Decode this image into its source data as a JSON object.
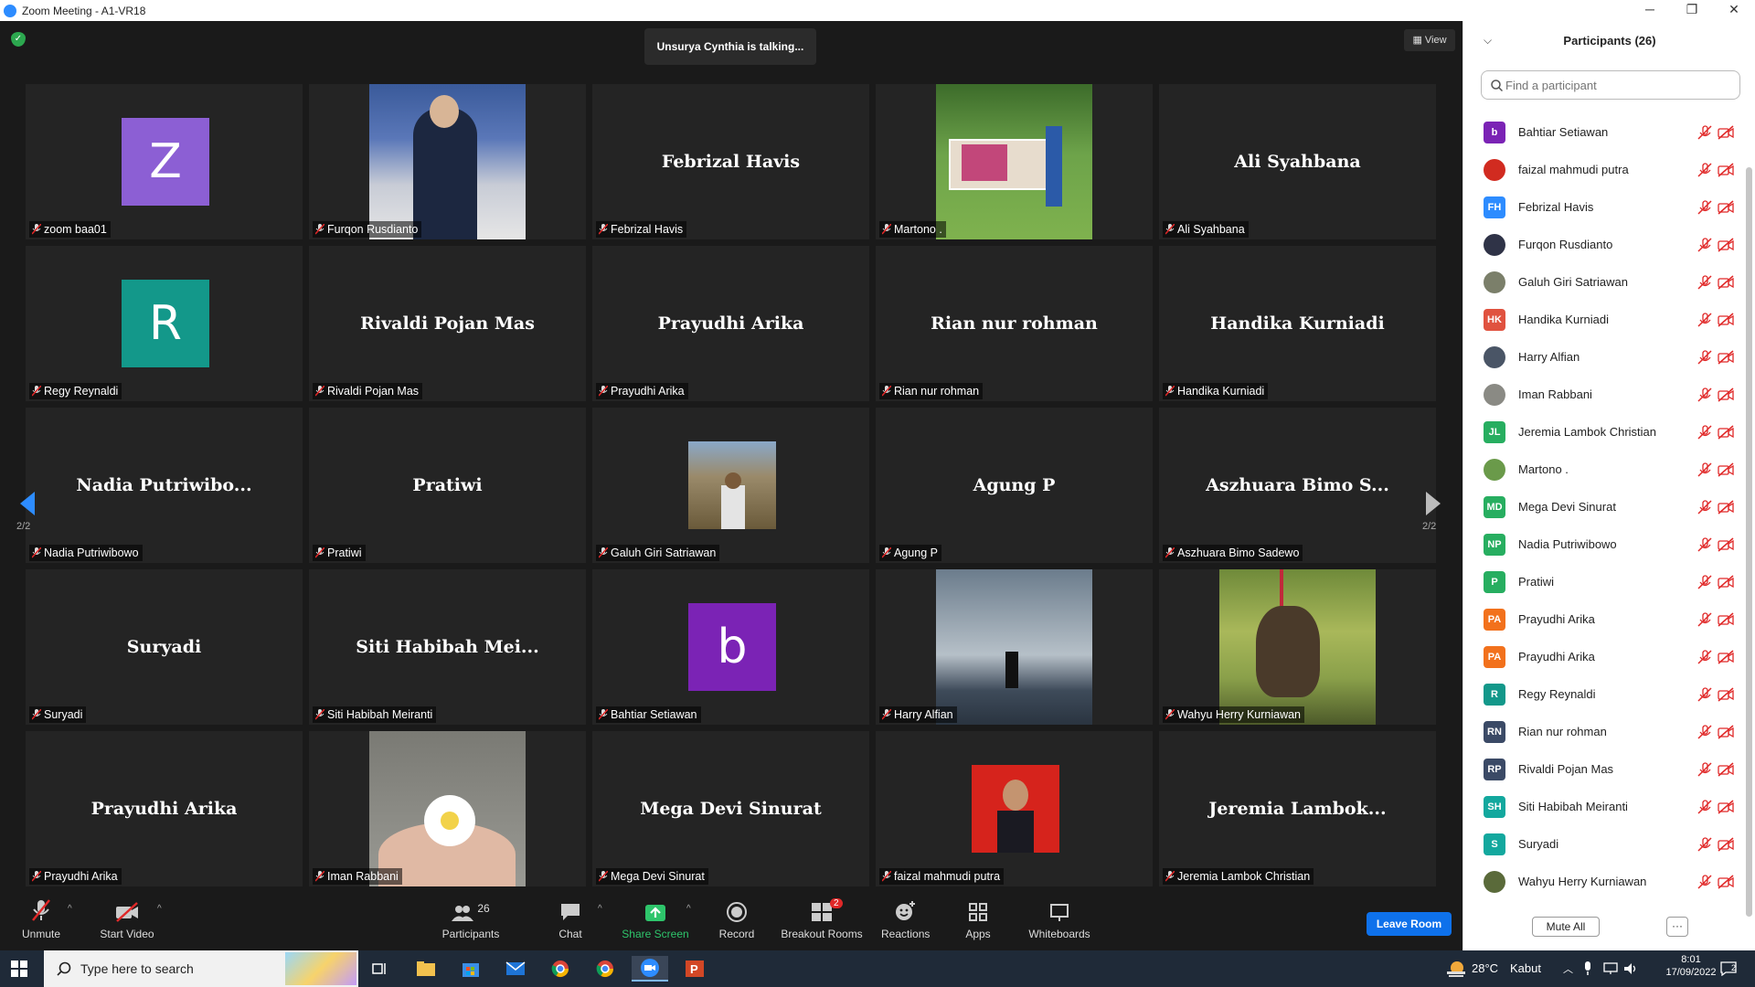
{
  "window": {
    "title": "Zoom Meeting - A1-VR18",
    "min_glyph": "─",
    "restore_glyph": "❐",
    "close_glyph": "✕"
  },
  "meeting": {
    "talking_text": "Unsurya Cynthia is talking...",
    "view_label": "View",
    "page_indicator_left": "2/2",
    "page_indicator_right": "2/2"
  },
  "tiles": [
    {
      "name": "zoom baa01",
      "type": "avatar",
      "letter": "Z",
      "color": "#8c5fd4"
    },
    {
      "name": "Furqon Rusdianto",
      "type": "photo",
      "photo": "person-event"
    },
    {
      "name": "Febrizal Havis",
      "type": "text",
      "display": "Febrizal Havis"
    },
    {
      "name": "Martono .",
      "type": "photo",
      "photo": "outdoor-banner"
    },
    {
      "name": "Ali Syahbana",
      "type": "text",
      "display": "Ali Syahbana"
    },
    {
      "name": "Regy Reynaldi",
      "type": "avatar",
      "letter": "R",
      "color": "#13988a"
    },
    {
      "name": "Rivaldi Pojan Mas",
      "type": "text",
      "display": "Rivaldi Pojan Mas"
    },
    {
      "name": "Prayudhi Arika",
      "type": "text",
      "display": "Prayudhi Arika"
    },
    {
      "name": "Rian nur rohman",
      "type": "text",
      "display": "Rian nur rohman"
    },
    {
      "name": "Handika Kurniadi",
      "type": "text",
      "display": "Handika Kurniadi"
    },
    {
      "name": "Nadia Putriwibowo",
      "type": "text",
      "display": "Nadia  Putriwibo..."
    },
    {
      "name": "Pratiwi",
      "type": "text",
      "display": "Pratiwi"
    },
    {
      "name": "Galuh Giri Satriawan",
      "type": "photo-small",
      "photo": "mountain-person"
    },
    {
      "name": "Agung P",
      "type": "text",
      "display": "Agung P"
    },
    {
      "name": "Aszhuara Bimo Sadewo",
      "type": "text",
      "display": "Aszhuara  Bimo  S..."
    },
    {
      "name": "Suryadi",
      "type": "text",
      "display": "Suryadi"
    },
    {
      "name": "Siti Habibah Meiranti",
      "type": "text",
      "display": "Siti  Habibah  Mei..."
    },
    {
      "name": "Bahtiar Setiawan",
      "type": "avatar",
      "letter": "b",
      "color": "#7b23b5"
    },
    {
      "name": "Harry Alfian",
      "type": "photo",
      "photo": "waterfall"
    },
    {
      "name": "Wahyu Herry Kurniawan",
      "type": "photo",
      "photo": "fishing"
    },
    {
      "name": "Prayudhi Arika",
      "type": "text",
      "display": "Prayudhi Arika"
    },
    {
      "name": "Iman Rabbani",
      "type": "photo",
      "photo": "flower-hand"
    },
    {
      "name": "Mega Devi Sinurat",
      "type": "text",
      "display": "Mega Devi Sinurat"
    },
    {
      "name": "faizal mahmudi putra",
      "type": "photo-small",
      "photo": "red-portrait"
    },
    {
      "name": "Jeremia Lambok Christian",
      "type": "text",
      "display": "Jeremia  Lambok..."
    }
  ],
  "toolbar": {
    "unmute": "Unmute",
    "start_video": "Start Video",
    "participants": "Participants",
    "participants_count": "26",
    "chat": "Chat",
    "share_screen": "Share Screen",
    "record": "Record",
    "breakout_rooms": "Breakout Rooms",
    "breakout_badge": "2",
    "reactions": "Reactions",
    "apps": "Apps",
    "whiteboards": "Whiteboards",
    "leave_room": "Leave Room",
    "caret_glyph": "^"
  },
  "panel": {
    "title": "Participants (26)",
    "search_placeholder": "Find a participant",
    "mute_all": "Mute All",
    "more": "···",
    "participants": [
      {
        "name": "Bahtiar Setiawan",
        "initials": "b",
        "color": "#7b23b5",
        "kind": "initials"
      },
      {
        "name": "faizal mahmudi putra",
        "initials": "",
        "color": "#d12b20",
        "kind": "photo"
      },
      {
        "name": "Febrizal Havis",
        "initials": "FH",
        "color": "#2d8cff",
        "kind": "initials"
      },
      {
        "name": "Furqon Rusdianto",
        "initials": "",
        "color": "#2f3347",
        "kind": "photo"
      },
      {
        "name": "Galuh Giri Satriawan",
        "initials": "",
        "color": "#7b7f6a",
        "kind": "photo"
      },
      {
        "name": "Handika Kurniadi",
        "initials": "HK",
        "color": "#e0523f",
        "kind": "initials"
      },
      {
        "name": "Harry Alfian",
        "initials": "",
        "color": "#4a5566",
        "kind": "photo"
      },
      {
        "name": "Iman Rabbani",
        "initials": "",
        "color": "#8a8a84",
        "kind": "photo"
      },
      {
        "name": "Jeremia Lambok Christian",
        "initials": "JL",
        "color": "#27ae60",
        "kind": "initials"
      },
      {
        "name": "Martono .",
        "initials": "",
        "color": "#6a9a4a",
        "kind": "photo"
      },
      {
        "name": "Mega Devi Sinurat",
        "initials": "MD",
        "color": "#27ae60",
        "kind": "initials"
      },
      {
        "name": "Nadia Putriwibowo",
        "initials": "NP",
        "color": "#27ae60",
        "kind": "initials"
      },
      {
        "name": "Pratiwi",
        "initials": "P",
        "color": "#27ae60",
        "kind": "initials"
      },
      {
        "name": "Prayudhi Arika",
        "initials": "PA",
        "color": "#f2711c",
        "kind": "initials"
      },
      {
        "name": "Prayudhi Arika",
        "initials": "PA",
        "color": "#f2711c",
        "kind": "initials"
      },
      {
        "name": "Regy Reynaldi",
        "initials": "R",
        "color": "#13988a",
        "kind": "initials"
      },
      {
        "name": "Rian nur rohman",
        "initials": "RN",
        "color": "#3b4a66",
        "kind": "initials"
      },
      {
        "name": "Rivaldi Pojan Mas",
        "initials": "RP",
        "color": "#3b4a66",
        "kind": "initials"
      },
      {
        "name": "Siti Habibah Meiranti",
        "initials": "SH",
        "color": "#13a89e",
        "kind": "initials"
      },
      {
        "name": "Suryadi",
        "initials": "S",
        "color": "#13a89e",
        "kind": "initials"
      },
      {
        "name": "Wahyu Herry Kurniawan",
        "initials": "",
        "color": "#5a6a3a",
        "kind": "photo"
      }
    ]
  },
  "taskbar": {
    "search_text": "Type here to search",
    "weather_temp": "28°C",
    "weather_text": "Kabut",
    "time": "8:01",
    "date": "17/09/2022",
    "notification_count": "2"
  }
}
